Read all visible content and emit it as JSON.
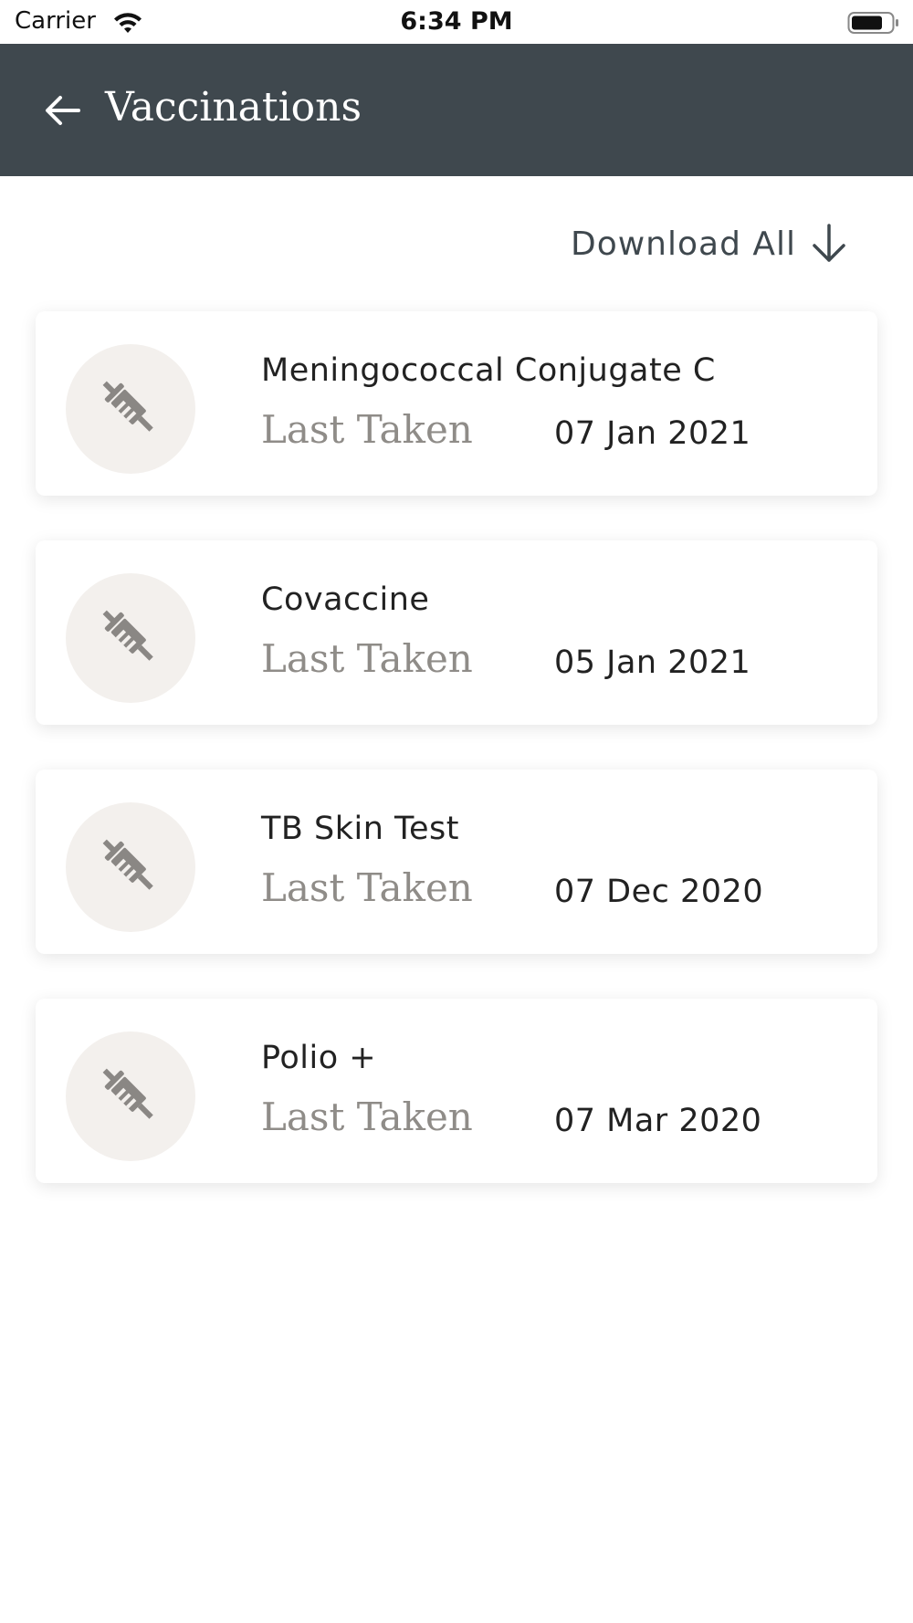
{
  "status_bar": {
    "carrier": "Carrier",
    "time": "6:34 PM",
    "wifi_icon": "wifi-icon",
    "battery_icon": "battery-icon"
  },
  "header": {
    "back_icon": "back-arrow-icon",
    "title": "Vaccinations",
    "background": "#3f484e"
  },
  "actions": {
    "download_all_label": "Download All",
    "download_icon": "arrow-down-icon"
  },
  "vaccinations": [
    {
      "name": "Meningococcal Conjugate C",
      "last_taken_label": "Last Taken",
      "date": "07 Jan 2021",
      "icon": "syringe-icon"
    },
    {
      "name": "Covaccine",
      "last_taken_label": "Last Taken",
      "date": "05 Jan 2021",
      "icon": "syringe-icon"
    },
    {
      "name": "TB Skin Test",
      "last_taken_label": "Last Taken",
      "date": "07 Dec 2020",
      "icon": "syringe-icon"
    },
    {
      "name": "Polio +",
      "last_taken_label": "Last Taken",
      "date": "07 Mar 2020",
      "icon": "syringe-icon"
    }
  ],
  "colors": {
    "header_bg": "#3f484e",
    "icon_circle_bg": "#f3f0ed",
    "icon_color": "#8a8784",
    "muted_text": "#8f8c88"
  }
}
